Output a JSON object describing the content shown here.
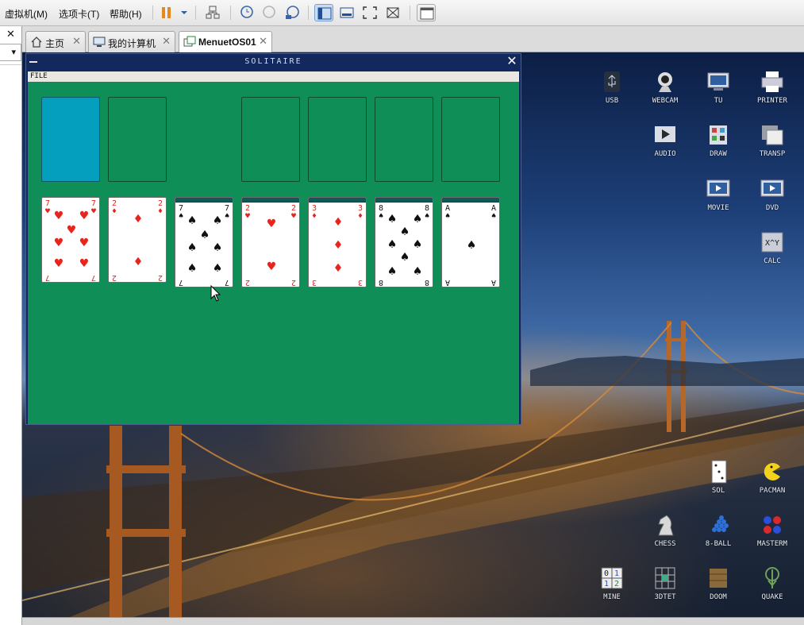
{
  "menubar": {
    "items": [
      "虚拟机(M)",
      "选项卡(T)",
      "帮助(H)"
    ]
  },
  "left_panel": {
    "close": "✕",
    "dropdown": "▾"
  },
  "tabs": [
    {
      "label": "主页",
      "icon": "home-icon",
      "close": "✕"
    },
    {
      "label": "我的计算机",
      "icon": "computer-icon",
      "close": "✕"
    },
    {
      "label": "MenuetOS01",
      "icon": "vm-icon",
      "close": "✕",
      "active": true
    }
  ],
  "window": {
    "title": "SOLITAIRE",
    "minimize": "—",
    "close": "✕",
    "menu": "FILE"
  },
  "solitaire": {
    "foundations": [
      "deck",
      "empty",
      "",
      "empty",
      "empty",
      "empty",
      "empty"
    ],
    "tableau": [
      {
        "rank": "7",
        "suit": "♥",
        "color": "red",
        "hidden": 0
      },
      {
        "rank": "2",
        "suit": "♦",
        "color": "red",
        "hidden": 0
      },
      {
        "rank": "7",
        "suit": "♠",
        "color": "black",
        "hidden": 1
      },
      {
        "rank": "2",
        "suit": "♥",
        "color": "red",
        "hidden": 1
      },
      {
        "rank": "3",
        "suit": "♦",
        "color": "red",
        "hidden": 1
      },
      {
        "rank": "8",
        "suit": "♠",
        "color": "black",
        "hidden": 1
      },
      {
        "rank": "A",
        "suit": "♠",
        "color": "black",
        "hidden": 1
      }
    ]
  },
  "desktop_icons": [
    {
      "label": "USB",
      "icon": "usb-icon"
    },
    {
      "label": "WEBCAM",
      "icon": "webcam-icon"
    },
    {
      "label": "TU",
      "icon": "tv-icon"
    },
    {
      "label": "PRINTER",
      "icon": "printer-icon"
    },
    {
      "label": "AUDIO",
      "icon": "audio-icon"
    },
    {
      "label": "DRAW",
      "icon": "draw-icon"
    },
    {
      "label": "TRANSP",
      "icon": "transparency-icon"
    },
    {
      "label": "MOVIE",
      "icon": "movie-icon"
    },
    {
      "label": "DVD",
      "icon": "dvd-icon"
    },
    {
      "label": "CALC",
      "icon": "calculator-icon"
    },
    {
      "label": "SOL",
      "icon": "solitaire-icon"
    },
    {
      "label": "PACMAN",
      "icon": "pacman-icon"
    },
    {
      "label": "CHESS",
      "icon": "chess-knight-icon"
    },
    {
      "label": "8-BALL",
      "icon": "billiards-icon"
    },
    {
      "label": "MASTERM",
      "icon": "mastermind-icon"
    },
    {
      "label": "MINE",
      "icon": "minesweeper-icon"
    },
    {
      "label": "3DTET",
      "icon": "tetris-icon"
    },
    {
      "label": "DOOM",
      "icon": "doom-icon"
    },
    {
      "label": "QUAKE",
      "icon": "quake-icon"
    }
  ],
  "colors": {
    "felt": "#0f8f57",
    "deck": "#049fbf",
    "title_bar": "#13295e",
    "red_suit": "#e8241c"
  }
}
